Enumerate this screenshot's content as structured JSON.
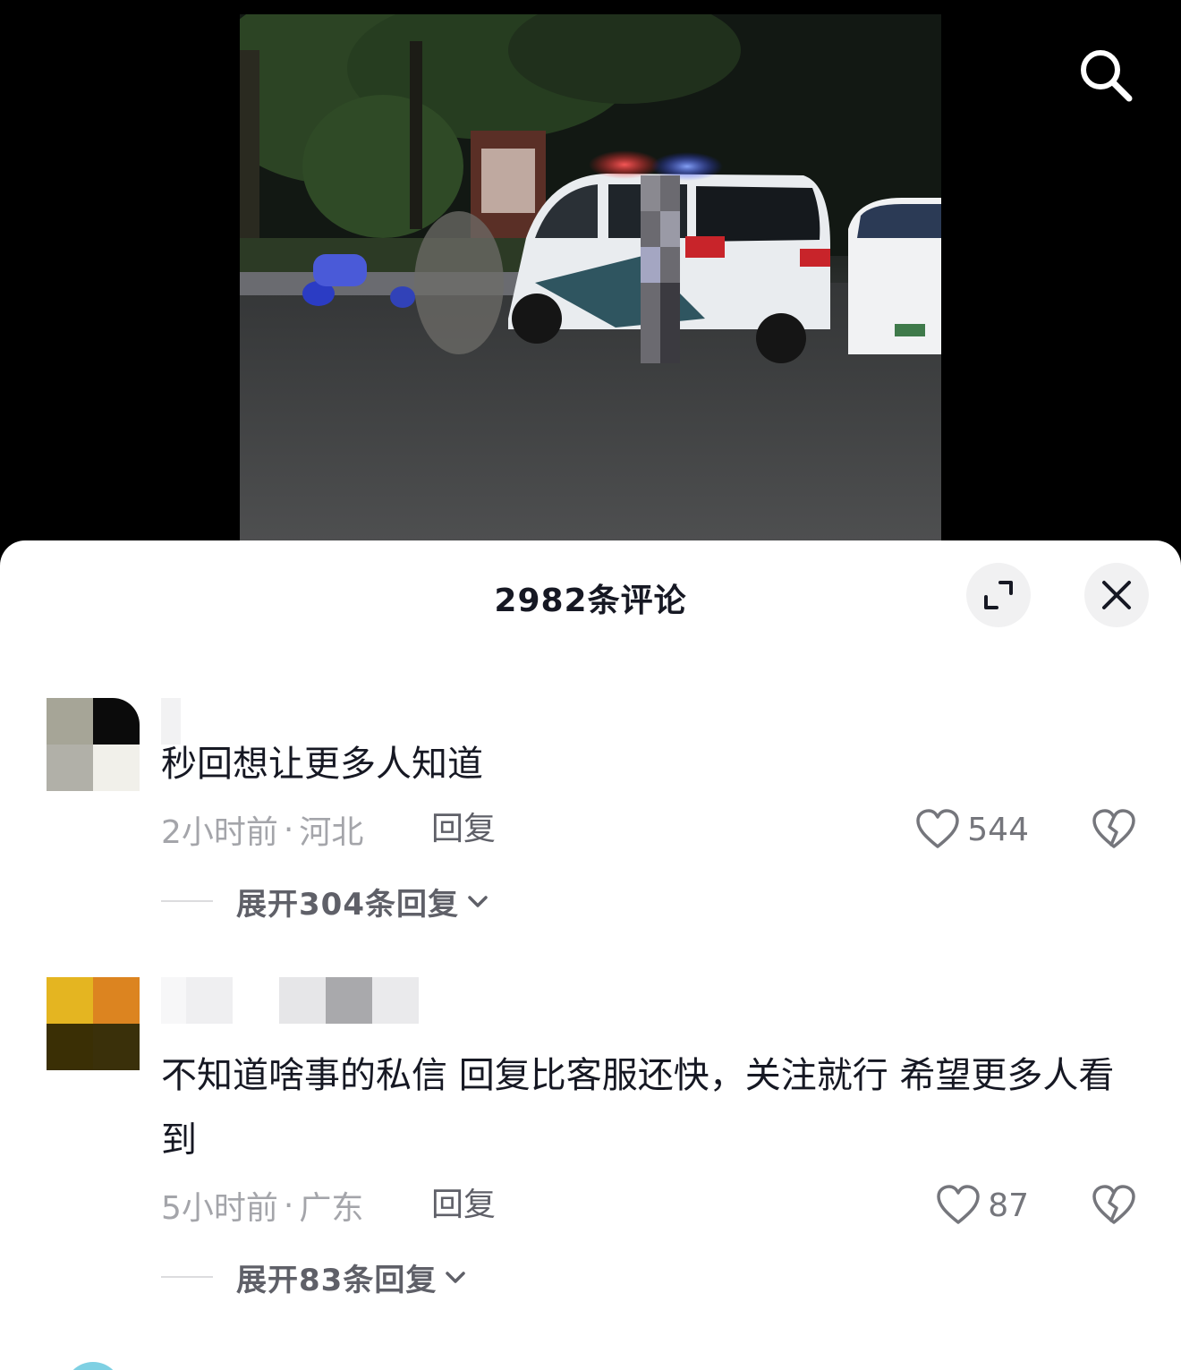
{
  "header": {
    "comment_count_title": "2982条评论",
    "search_icon": "search-icon",
    "expand_icon": "expand-icon",
    "close_icon": "close-icon"
  },
  "comments": [
    {
      "avatar_colors": [
        "#a6a597",
        "#0b0b0b",
        "#b1b0a8",
        "#f1f0ea"
      ],
      "username_blocks": [
        "#f2f2f3"
      ],
      "text": "秒回想让更多人知道",
      "time": "2小时前",
      "separator": "·",
      "location": "河北",
      "reply_label": "回复",
      "likes": "544",
      "expand_label": "展开304条回复"
    },
    {
      "avatar_colors": [
        "#e4b521",
        "#dc8420",
        "#3a2f05",
        "#3a300a"
      ],
      "username_blocks": [
        "#f7f7f8",
        "#efeff1",
        "#ffffff",
        "#e6e6e8",
        "#a9a9ac",
        "#eaeaec"
      ],
      "text": "不知道啥事的私信 回复比客服还快，关注就行 希望更多人看到",
      "time": "5小时前",
      "separator": "·",
      "location": "广东",
      "reply_label": "回复",
      "likes": "87",
      "expand_label": "展开83条回复"
    }
  ],
  "colors": {
    "text_primary": "#161823",
    "text_secondary": "#a4a5aa",
    "button_bg": "#f1f1f2"
  }
}
